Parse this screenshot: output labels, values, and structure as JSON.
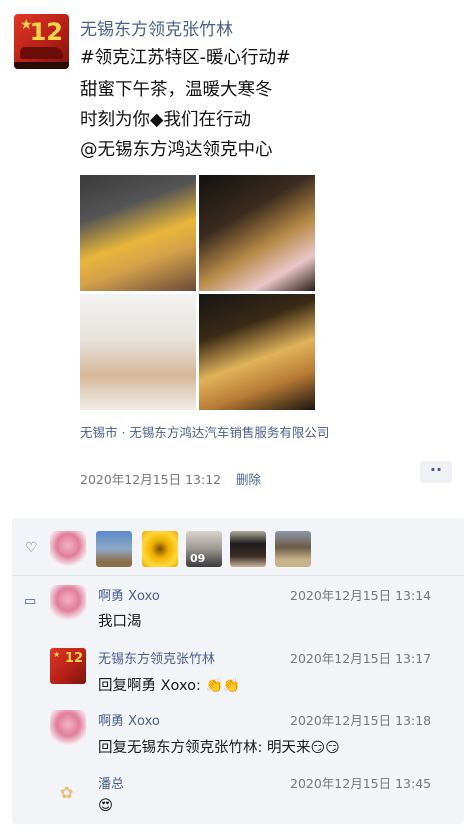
{
  "post": {
    "author": "无锡东方领克张竹林",
    "lines": [
      "#领克江苏特区-暖心行动#",
      "甜蜜下午茶，温暖大寒冬",
      "时刻为你◆我们在行动",
      "@无锡东方鸿达领克中心"
    ],
    "location": "无锡市 · 无锡东方鸿达汽车销售服务有限公司",
    "time": "2020年12月15日 13:12",
    "delete_label": "删除",
    "more_label": "··"
  },
  "likes": {
    "heart_icon": "heart-icon"
  },
  "comments": [
    {
      "author": "啊勇 Xoxo",
      "time": "2020年12月15日 13:14",
      "text": "我口渴"
    },
    {
      "author": "无锡东方领克张竹林",
      "time": "2020年12月15日 13:17",
      "text": "回复啊勇 Xoxo: ",
      "emoji": "👏👏"
    },
    {
      "author": "啊勇 Xoxo",
      "time": "2020年12月15日 13:18",
      "text": "回复无锡东方领克张竹林: 明天来",
      "emoji": "😏😏"
    },
    {
      "author": "潘总",
      "time": "2020年12月15日 13:45",
      "text": "😍"
    }
  ],
  "avatar_text": {
    "main_num": "12",
    "like4_text": "09"
  }
}
